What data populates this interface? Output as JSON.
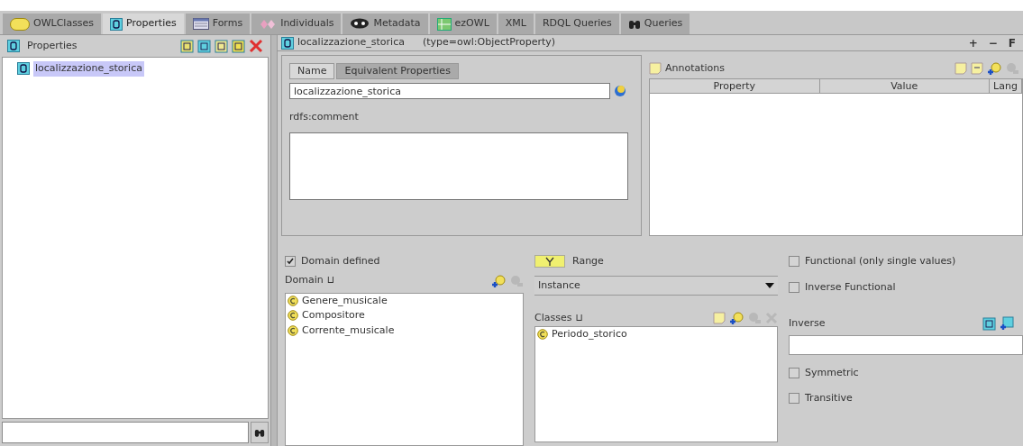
{
  "tabs": [
    {
      "label": "OWLClasses",
      "selected": false
    },
    {
      "label": "Properties",
      "selected": true
    },
    {
      "label": "Forms",
      "selected": false
    },
    {
      "label": "Individuals",
      "selected": false
    },
    {
      "label": "Metadata",
      "selected": false
    },
    {
      "label": "ezOWL",
      "selected": false
    },
    {
      "label": "XML",
      "selected": false
    },
    {
      "label": "RDQL Queries",
      "selected": false
    },
    {
      "label": "Queries",
      "selected": false
    }
  ],
  "properties_panel": {
    "title": "Properties",
    "tree": [
      {
        "label": "localizzazione_storica",
        "selected": true
      }
    ]
  },
  "editor": {
    "title": "localizzazione_storica",
    "type": "(type=owl:ObjectProperty)",
    "header_buttons": [
      "+",
      "−",
      "F"
    ],
    "name_tabs": [
      {
        "label": "Name",
        "selected": true
      },
      {
        "label": "Equivalent Properties",
        "selected": false
      }
    ],
    "name_value": "localizzazione_storica",
    "comment_label": "rdfs:comment",
    "annotations": {
      "title": "Annotations",
      "columns": [
        "Property",
        "Value",
        "Lang"
      ]
    },
    "domain": {
      "defined_label": "Domain defined",
      "defined_checked": true,
      "label": "Domain",
      "symbol": "⊔",
      "items": [
        "Genere_musicale",
        "Compositore",
        "Corrente_musicale"
      ]
    },
    "range": {
      "title": "Range",
      "value": "Instance",
      "classes_label": "Classes",
      "symbol": "⊔",
      "items": [
        "Periodo_storico"
      ]
    },
    "characteristics_top": [
      {
        "label": "Functional (only single values)",
        "checked": false
      },
      {
        "label": "Inverse Functional",
        "checked": false
      }
    ],
    "inverse_label": "Inverse",
    "characteristics_bottom": [
      {
        "label": "Symmetric",
        "checked": false
      },
      {
        "label": "Transitive",
        "checked": false
      }
    ]
  }
}
